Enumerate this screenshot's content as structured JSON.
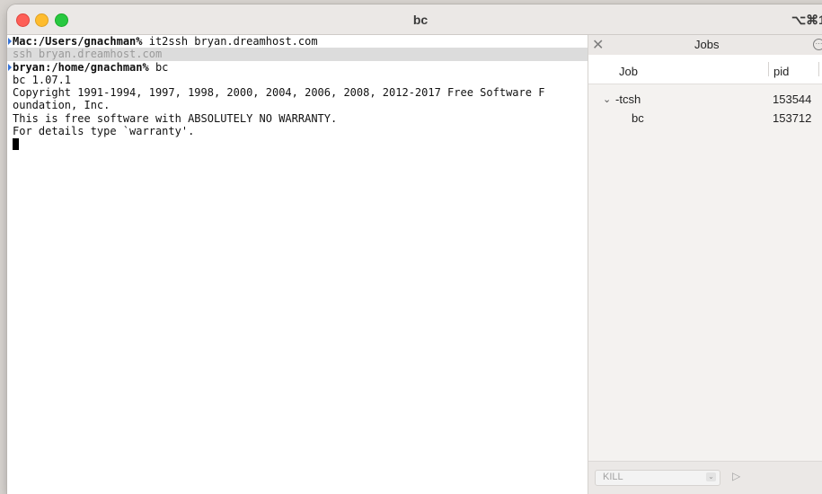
{
  "window": {
    "title": "bc",
    "shortcut": "⌥⌘1"
  },
  "terminal": {
    "lines": [
      {
        "prompt": "Mac:/Users/gnachman%",
        "text": " it2ssh bryan.dreamhost.com"
      },
      {
        "text": "ssh bryan.dreamhost.com"
      },
      {
        "prompt": "bryan:/home/gnachman%",
        "text": " bc"
      },
      {
        "text": "bc 1.07.1"
      },
      {
        "text": "Copyright 1991-1994, 1997, 1998, 2000, 2004, 2006, 2008, 2012-2017 Free Software F"
      },
      {
        "text": "oundation, Inc."
      },
      {
        "text": "This is free software with ABSOLUTELY NO WARRANTY."
      },
      {
        "text": "For details type `warranty'."
      }
    ]
  },
  "jobs": {
    "title": "Jobs",
    "headers": {
      "job": "Job",
      "pid": "pid"
    },
    "rows": [
      {
        "name": "-tcsh",
        "pid": "153544"
      },
      {
        "name": "bc",
        "pid": "153712"
      }
    ],
    "signal": "KILL"
  }
}
